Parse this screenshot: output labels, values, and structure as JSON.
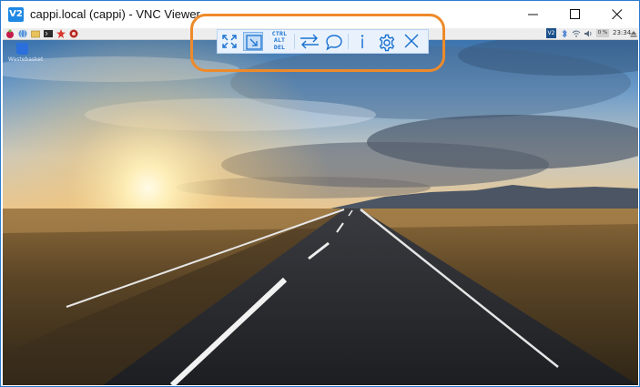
{
  "window": {
    "title": "cappi.local (cappi) - VNC Viewer",
    "app_icon_text": "V2",
    "controls": {
      "minimize": "minimize-icon",
      "maximize": "maximize-icon",
      "close": "close-icon"
    },
    "frame_color": "#2b7bd0"
  },
  "remote_desktop": {
    "panel": {
      "launcher_icons": [
        "raspberry-menu-icon",
        "web-browser-icon",
        "file-manager-icon",
        "terminal-icon",
        "wolfram-icon",
        "mathematica-icon"
      ],
      "tray": {
        "vnc_icon": "V2",
        "bluetooth_icon": "bluetooth-icon",
        "wifi_icon": "wifi-icon",
        "volume_icon": "volume-icon",
        "cpu_monitor": "0 %",
        "clock": "23:34",
        "eject_icon": "eject-icon"
      }
    },
    "desktop_icons": [
      {
        "label": "Wastebasket",
        "icon": "trash-icon"
      }
    ],
    "wallpaper": "road-at-sunset"
  },
  "vnc_toolbar": {
    "buttons": [
      {
        "name": "fullscreen",
        "icon": "expand-icon",
        "active": false
      },
      {
        "name": "scale",
        "icon": "scale-icon",
        "active": true
      },
      {
        "name": "ctrl-alt-del",
        "label_lines": [
          "CTRL",
          "ALT",
          "DEL"
        ],
        "active": false
      },
      {
        "name": "file-transfer",
        "icon": "transfer-arrows-icon",
        "active": false
      },
      {
        "name": "chat",
        "icon": "chat-bubble-icon",
        "active": false
      },
      {
        "name": "info",
        "icon": "info-icon",
        "active": false
      },
      {
        "name": "properties",
        "icon": "gear-icon",
        "active": false
      },
      {
        "name": "close-toolbar",
        "icon": "close-icon",
        "active": false
      }
    ],
    "accent": "#1b72d1",
    "background": "#e9f2fc"
  },
  "annotation": {
    "highlight_color": "#ee8a2a"
  }
}
